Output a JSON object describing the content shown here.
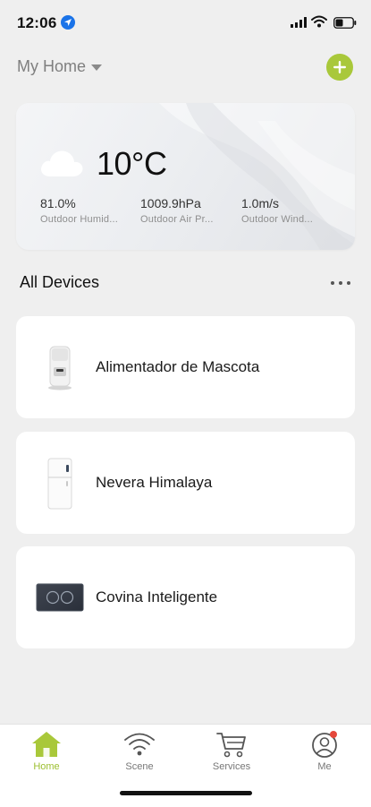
{
  "status_bar": {
    "time": "12:06",
    "icons": [
      "location-arrow-icon",
      "cellular-signal-icon",
      "wifi-icon",
      "battery-icon"
    ]
  },
  "header": {
    "home_name": "My Home",
    "add_icon": "plus-circle-icon"
  },
  "weather": {
    "icon": "cloud-icon",
    "temperature": "10°C",
    "metrics": [
      {
        "value": "81.0%",
        "label": "Outdoor Humid..."
      },
      {
        "value": "1009.9hPa",
        "label": "Outdoor Air Pr..."
      },
      {
        "value": "1.0m/s",
        "label": "Outdoor Wind..."
      }
    ]
  },
  "devices_section": {
    "title": "All Devices",
    "more_icon": "more-dots-icon"
  },
  "devices": [
    {
      "name": "Alimentador de Mascota",
      "icon": "pet-feeder-icon"
    },
    {
      "name": "Nevera Himalaya",
      "icon": "fridge-icon"
    },
    {
      "name": "Covina Inteligente",
      "icon": "smart-hob-icon"
    }
  ],
  "tabs": [
    {
      "label": "Home",
      "icon": "home-icon",
      "active": true
    },
    {
      "label": "Scene",
      "icon": "scene-icon",
      "active": false
    },
    {
      "label": "Services",
      "icon": "cart-icon",
      "active": false
    },
    {
      "label": "Me",
      "icon": "profile-icon",
      "active": false,
      "badge": true
    }
  ],
  "colors": {
    "accent": "#a9c83a",
    "background": "#efefef",
    "card": "#ffffff",
    "notification": "#e5483b"
  }
}
